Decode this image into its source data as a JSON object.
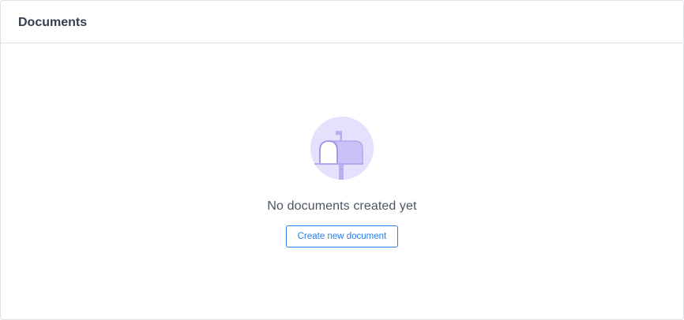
{
  "card": {
    "title": "Documents"
  },
  "empty_state": {
    "icon": "mailbox-icon",
    "message": "No documents created yet",
    "create_button_label": "Create new document"
  },
  "colors": {
    "accent": "#2c7be5",
    "illustration_bg": "#e5e0fb",
    "illustration_fg": "#b9aef2"
  }
}
